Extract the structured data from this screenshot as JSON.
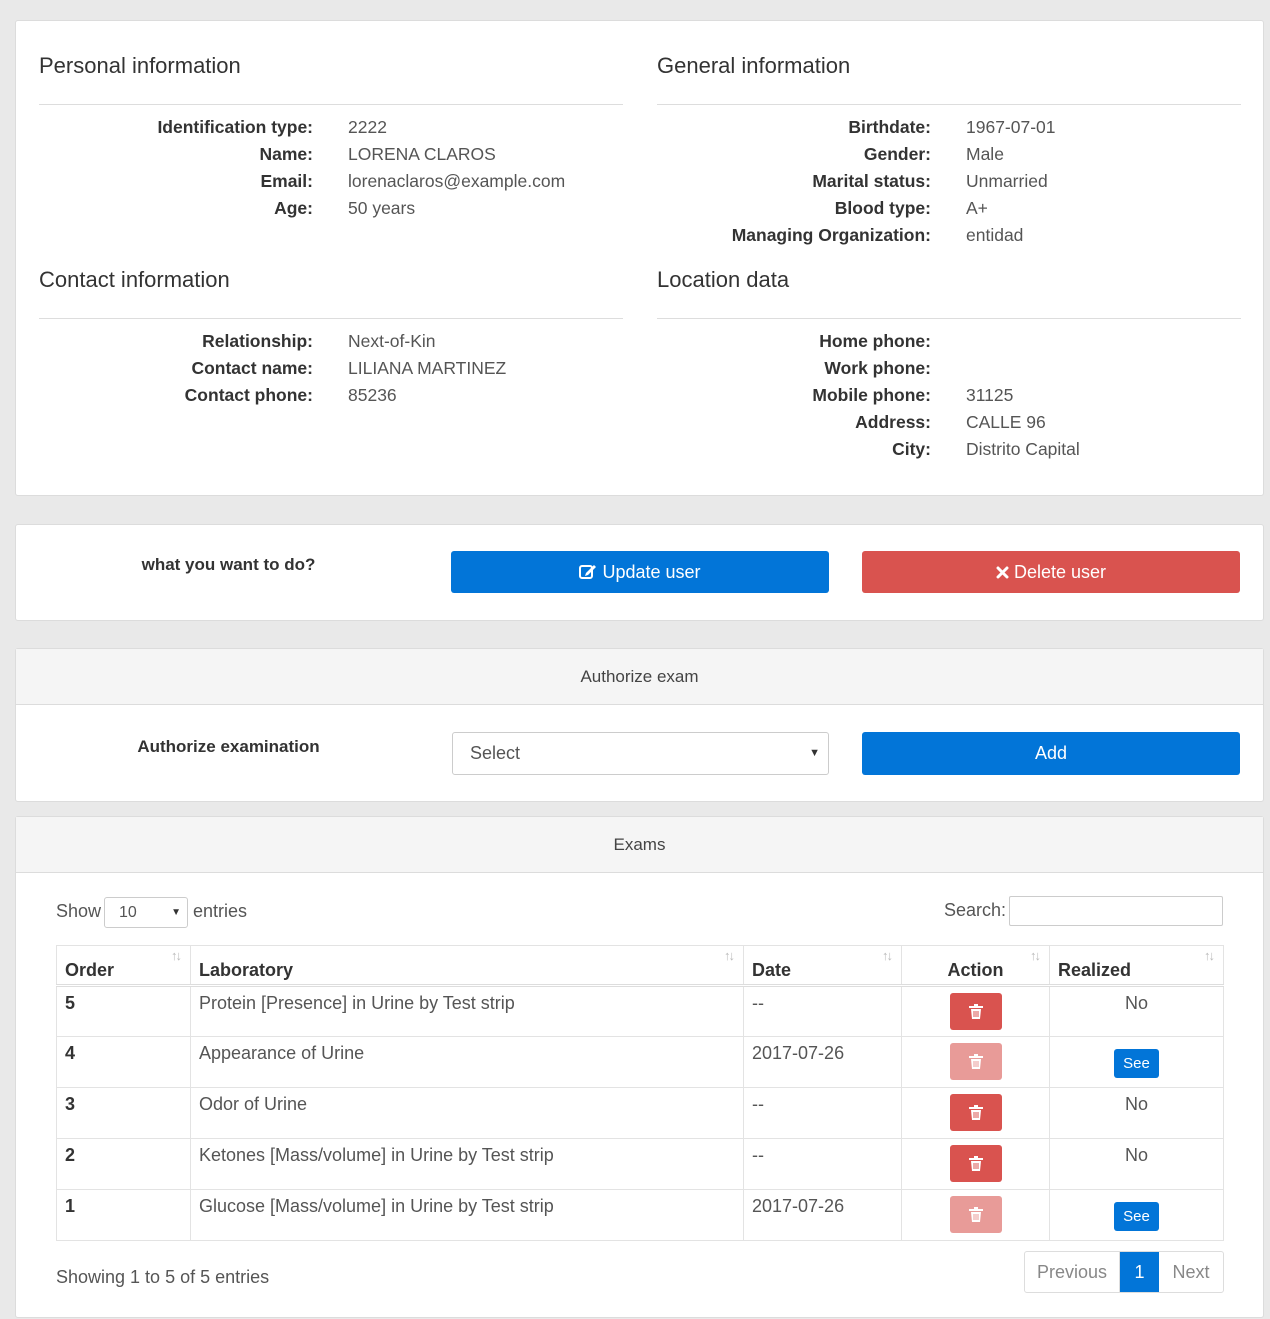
{
  "personal": {
    "title": "Personal information",
    "fields": [
      {
        "label": "Identification type:",
        "value": "2222"
      },
      {
        "label": "Name:",
        "value": "LORENA CLAROS"
      },
      {
        "label": "Email:",
        "value": "lorenaclaros@example.com"
      },
      {
        "label": "Age:",
        "value": "50 years"
      }
    ]
  },
  "general": {
    "title": "General information",
    "fields": [
      {
        "label": "Birthdate:",
        "value": "1967-07-01"
      },
      {
        "label": "Gender:",
        "value": "Male"
      },
      {
        "label": "Marital status:",
        "value": "Unmarried"
      },
      {
        "label": "Blood type:",
        "value": "A+"
      },
      {
        "label": "Managing Organization:",
        "value": "entidad"
      }
    ]
  },
  "contact": {
    "title": "Contact information",
    "fields": [
      {
        "label": "Relationship:",
        "value": "Next-of-Kin"
      },
      {
        "label": "Contact name:",
        "value": "LILIANA MARTINEZ"
      },
      {
        "label": "Contact phone:",
        "value": "85236"
      }
    ]
  },
  "location": {
    "title": "Location data",
    "fields": [
      {
        "label": "Home phone:",
        "value": ""
      },
      {
        "label": "Work phone:",
        "value": ""
      },
      {
        "label": "Mobile phone:",
        "value": "31125"
      },
      {
        "label": "Address:",
        "value": "CALLE 96"
      },
      {
        "label": "City:",
        "value": "Distrito Capital"
      }
    ]
  },
  "actions": {
    "prompt": "what you want to do?",
    "update_label": "Update user",
    "update_icon": "edit-icon",
    "delete_label": "Delete user",
    "delete_icon": "times-icon"
  },
  "authorize": {
    "heading": "Authorize exam",
    "label": "Authorize examination",
    "select_value": "Select",
    "add_label": "Add"
  },
  "exams": {
    "heading": "Exams",
    "show_label": "Show",
    "page_length": "10",
    "entries_label": "entries",
    "search_label": "Search:",
    "search_value": "",
    "columns": [
      "Order",
      "Laboratory",
      "Date",
      "Action",
      "Realized"
    ],
    "rows": [
      {
        "order": "5",
        "laboratory": "Protein [Presence] in Urine by Test strip",
        "date": "--",
        "delete_enabled": true,
        "realized": "No"
      },
      {
        "order": "4",
        "laboratory": "Appearance of Urine",
        "date": "2017-07-26",
        "delete_enabled": false,
        "realized": "See"
      },
      {
        "order": "3",
        "laboratory": "Odor of Urine",
        "date": "--",
        "delete_enabled": true,
        "realized": "No"
      },
      {
        "order": "2",
        "laboratory": "Ketones [Mass/volume] in Urine by Test strip",
        "date": "--",
        "delete_enabled": true,
        "realized": "No"
      },
      {
        "order": "1",
        "laboratory": "Glucose [Mass/volume] in Urine by Test strip",
        "date": "2017-07-26",
        "delete_enabled": false,
        "realized": "See"
      }
    ],
    "info": "Showing 1 to 5 of 5 entries",
    "pager": {
      "previous": "Previous",
      "current": "1",
      "next": "Next"
    }
  },
  "colors": {
    "primary": "#0275d8",
    "danger": "#d9534f",
    "danger_disabled": "#e89b98",
    "background": "#e9e9e9"
  }
}
